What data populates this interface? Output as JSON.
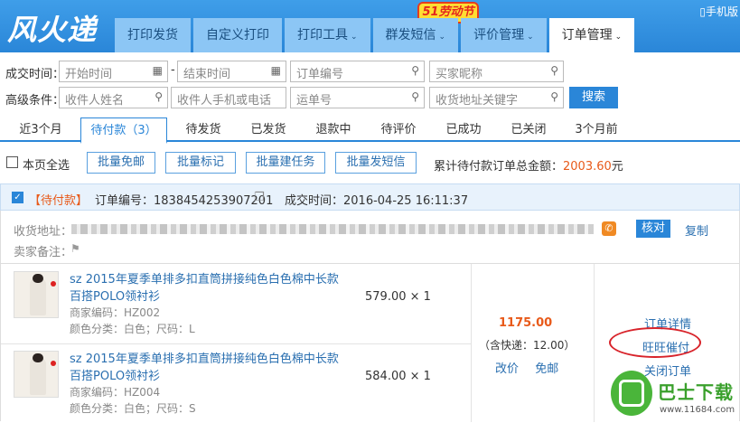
{
  "header": {
    "logo": "风火递",
    "badge": "51劳动节",
    "mobile": "手机版",
    "tabs": [
      {
        "label": "打印发货",
        "dropdown": false
      },
      {
        "label": "自定义打印",
        "dropdown": false
      },
      {
        "label": "打印工具",
        "dropdown": true
      },
      {
        "label": "群发短信",
        "dropdown": true
      },
      {
        "label": "评价管理",
        "dropdown": true
      },
      {
        "label": "订单管理",
        "dropdown": true,
        "active": true
      }
    ],
    "caret": "⌄"
  },
  "search": {
    "row1_label": "成交时间：",
    "start_placeholder": "开始时间",
    "dash": "-",
    "end_placeholder": "结束时间",
    "order_no_placeholder": "订单编号",
    "buyer_placeholder": "买家昵称",
    "row2_label": "高级条件：",
    "recipient_placeholder": "收件人姓名",
    "phone_placeholder": "收件人手机或电话",
    "waybill_placeholder": "运单号",
    "address_placeholder": "收货地址关键字",
    "search_button": "搜索"
  },
  "status_tabs": [
    "近3个月",
    "待付款（3）",
    "待发货",
    "已发货",
    "退款中",
    "待评价",
    "已成功",
    "已关闭",
    "3个月前"
  ],
  "bulk": {
    "select_all": "本页全选",
    "buttons": [
      "批量免邮",
      "批量标记",
      "批量建任务",
      "批量发短信"
    ],
    "total_prefix": "累计待付款订单总金额：",
    "total_amount": "2003.60",
    "total_suffix": "元"
  },
  "order": {
    "status": "【待付款】",
    "order_no_label": "订单编号：",
    "order_no": "1838454253907201",
    "time_label": "成交时间：",
    "time": "2016-04-25 16:11:37",
    "address_label": "收货地址：",
    "note_label": "卖家备注：",
    "verify_button": "核对",
    "copy_link": "复制",
    "items": [
      {
        "title": "sz 2015年夏季单排多扣直筒拼接纯色白色棉中长款百搭POLO领衬衫",
        "code": "商家编码：HZ002",
        "spec": "颜色分类：白色；尺码：L",
        "price": "579.00 × 1"
      },
      {
        "title": "sz 2015年夏季单排多扣直筒拼接纯色白色棉中长款百搭POLO领衬衫",
        "code": "商家编码：HZ004",
        "spec": "颜色分类：白色；尺码：S",
        "price": "584.00 × 1"
      }
    ],
    "payment": "1175.00",
    "shipping": "（含快递：12.00）",
    "modify_price": "改价",
    "free_shipping": "免邮",
    "ops": [
      "订单详情",
      "旺旺催付",
      "关闭订单"
    ]
  },
  "watermark": {
    "text": "巴士下载",
    "url": "www.11684.com"
  },
  "colors": {
    "primary": "#2a86d8",
    "accent": "#e85a1a",
    "highlight_ring": "#d8232a"
  }
}
